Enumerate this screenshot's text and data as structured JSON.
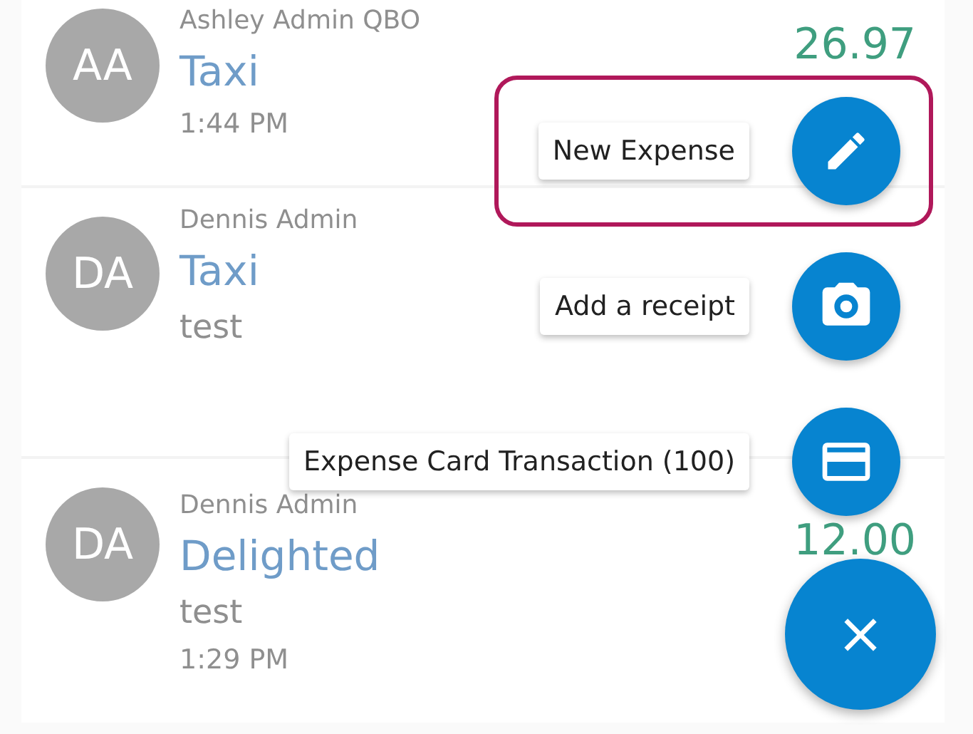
{
  "expenses": [
    {
      "initials": "AA",
      "name": "Ashley Admin QBO",
      "title": "Taxi",
      "time": "1:44 PM",
      "amount": "26.97"
    },
    {
      "initials": "DA",
      "name": "Dennis Admin",
      "title": "Taxi",
      "note": "test"
    },
    {
      "initials": "DA",
      "name": "Dennis Admin",
      "title": "Delighted",
      "note": "test",
      "time": "1:29 PM",
      "amount": "12.00"
    }
  ],
  "speed_dial": {
    "actions": [
      {
        "kind": "pencil",
        "label": "New Expense",
        "highlighted": true
      },
      {
        "kind": "camera",
        "label": "Add a receipt",
        "highlighted": false
      },
      {
        "kind": "card",
        "label": "Expense Card Transaction (100)",
        "highlighted": false
      }
    ],
    "close_icon": "×"
  }
}
